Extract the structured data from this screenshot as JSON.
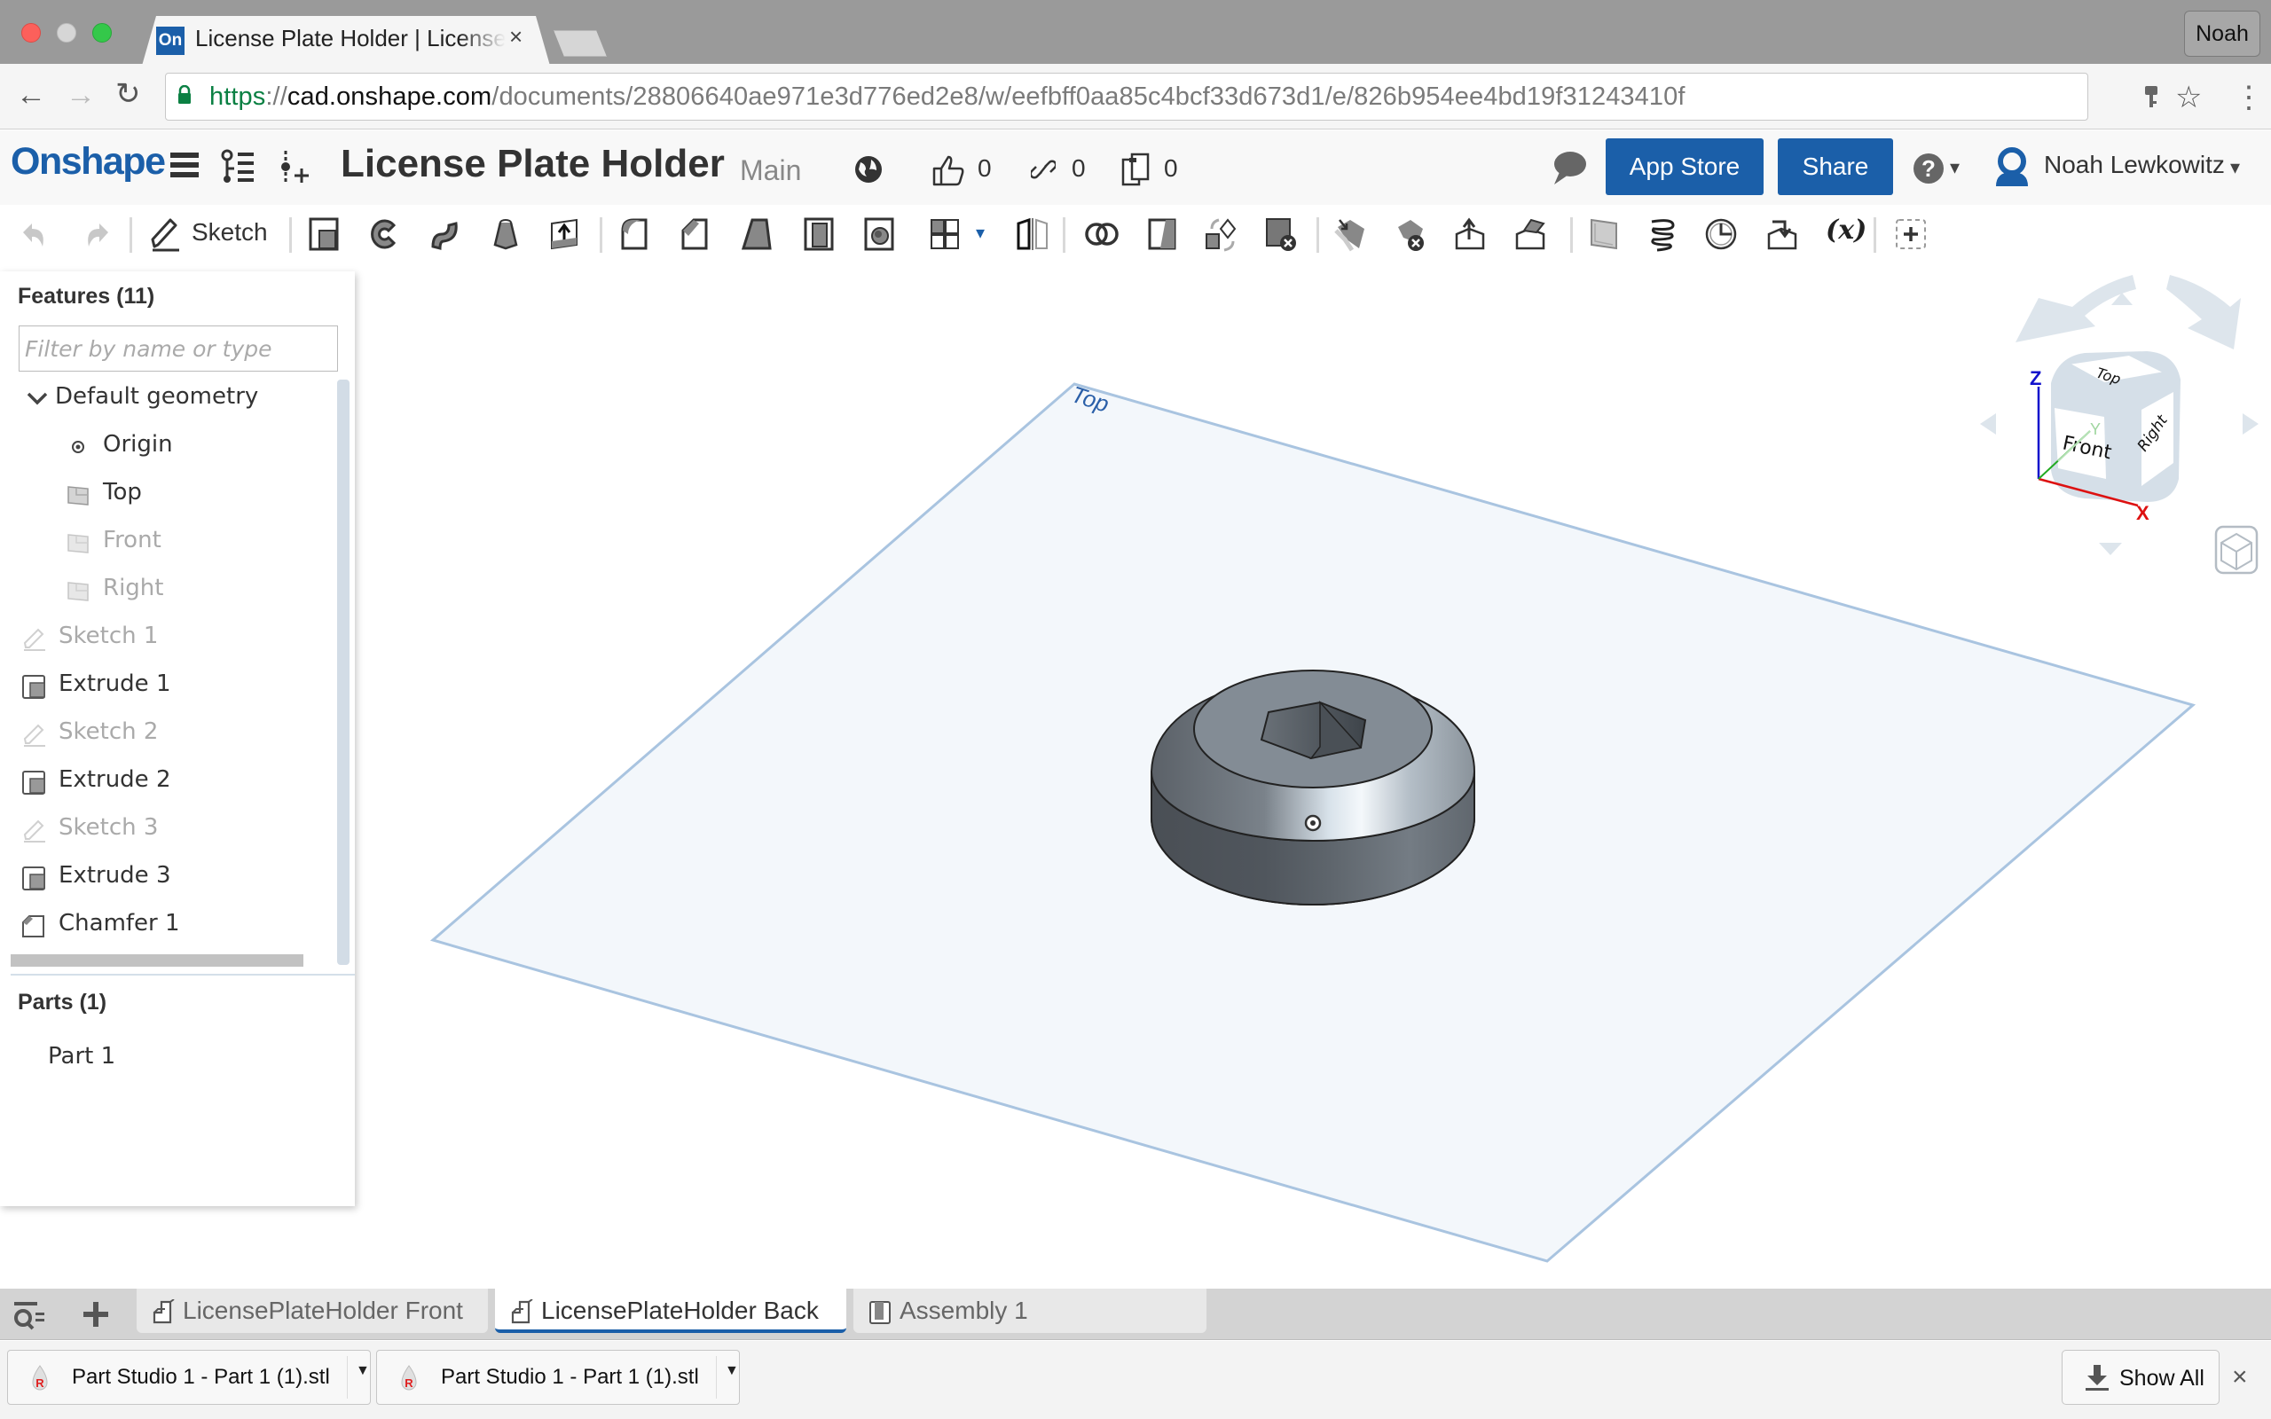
{
  "browser": {
    "tab_title": "License Plate Holder | LicensePlateHolder Back",
    "tab_favicon": "On",
    "tab_close": "×",
    "profile_name": "Noah",
    "url_scheme": "https",
    "url_sep": "://",
    "url_host": "cad.onshape.com",
    "url_path": "/documents/28806640ae971e3d776ed2e8/w/eefbff0aa85c4bcf33d673d1/e/826b954ee4bd19f31243410f",
    "nav": {
      "back": "←",
      "forward": "→",
      "reload": "↻",
      "key": "🔑",
      "star": "☆",
      "menu": "⋮"
    }
  },
  "header": {
    "logo": "Onshape",
    "document_title": "License Plate Holder",
    "workspace": "Main",
    "likes": "0",
    "links": "0",
    "copies": "0",
    "app_store_label": "App Store",
    "share_label": "Share",
    "help_caret": "▾",
    "user_name": "Noah Lewkowitz",
    "user_caret": "▾"
  },
  "toolbar": {
    "sketch_label": "Sketch",
    "tools": [
      "extrude",
      "revolve",
      "sweep",
      "loft",
      "thicken",
      "fillet",
      "chamfer",
      "draft",
      "shell",
      "hole",
      "pattern",
      "mirror",
      "boolean",
      "split",
      "transform",
      "delete-part",
      "move-face",
      "delete-face",
      "modify-fillet",
      "replace-face",
      "plane",
      "helix",
      "mate-connector",
      "import",
      "variable",
      "add-custom-feature"
    ],
    "pattern_caret": "▾",
    "variable_label": "(x)"
  },
  "features": {
    "heading": "Features (11)",
    "filter_placeholder": "Filter by name or type",
    "items": [
      {
        "label": "Default geometry",
        "kind": "group",
        "dim": false
      },
      {
        "label": "Origin",
        "kind": "origin",
        "dim": false
      },
      {
        "label": "Top",
        "kind": "plane",
        "dim": false
      },
      {
        "label": "Front",
        "kind": "plane",
        "dim": true
      },
      {
        "label": "Right",
        "kind": "plane",
        "dim": true
      },
      {
        "label": "Sketch 1",
        "kind": "sketch",
        "dim": true
      },
      {
        "label": "Extrude 1",
        "kind": "extrude",
        "dim": false
      },
      {
        "label": "Sketch 2",
        "kind": "sketch",
        "dim": true
      },
      {
        "label": "Extrude 2",
        "kind": "extrude",
        "dim": false
      },
      {
        "label": "Sketch 3",
        "kind": "sketch",
        "dim": true
      },
      {
        "label": "Extrude 3",
        "kind": "extrude",
        "dim": false
      },
      {
        "label": "Chamfer 1",
        "kind": "chamfer",
        "dim": false
      }
    ]
  },
  "parts": {
    "heading": "Parts (1)",
    "items": [
      "Part 1"
    ]
  },
  "viewport": {
    "plane_label": "Top",
    "view_cube": {
      "top": "Top",
      "front": "Front",
      "right": "Right",
      "axis_x": "X",
      "axis_y": "Y",
      "axis_z": "Z"
    },
    "colors": {
      "x_axis": "#dd1111",
      "y_axis": "#22aa22",
      "z_axis": "#1111cc",
      "plane_edge": "#a9c4e0",
      "plane_fill": "#f3f7fb",
      "plane_label": "#2a5fa8"
    }
  },
  "element_tabs": [
    {
      "label": "LicensePlateHolder Front",
      "type": "part-studio",
      "active": false
    },
    {
      "label": "LicensePlateHolder Back",
      "type": "part-studio",
      "active": true
    },
    {
      "label": "Assembly 1",
      "type": "assembly",
      "active": false
    }
  ],
  "downloads": {
    "items": [
      "Part Studio 1 - Part 1 (1).stl",
      "Part Studio 1 - Part 1 (1).stl"
    ],
    "show_all_label": "Show All",
    "close": "×"
  },
  "colors": {
    "brand_blue": "#1b5fa9",
    "active_tab_underline": "#1b5fa9"
  }
}
